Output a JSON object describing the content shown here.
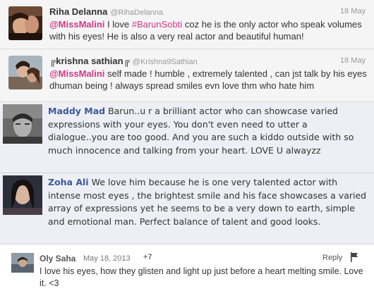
{
  "tweets": [
    {
      "name": "Riha Delanna",
      "handle": "@RihaDelanna",
      "date": "18 May",
      "mention": "@MissMalini",
      "text_a": " I love ",
      "hashtag": "#BarunSobti",
      "text_b": " coz he is the only actor who speak volumes with his eyes! He is also a very real actor and beautiful human!"
    },
    {
      "name": "╔krishna sathian╔",
      "handle": "@Krishna9Sathian",
      "date": "18 May",
      "mention": "@MissMalini",
      "text_a": " self made ! humble , extremely talented , can jst talk by his eyes dhuman being ! always spread smiles evn love thm who hate him"
    }
  ],
  "fb_comments": [
    {
      "author": "Maddy Mad",
      "text": " Barun..u r a brilliant actor who can showcase varied expressions with your eyes. You don't even need to utter a dialogue..you are too good. And you are such a kiddo outside with so much innocence and talking from your heart. LOVE U alwayzz"
    },
    {
      "author": "Zoha Ali",
      "text": " We love him because he is one very talented actor with intense most eyes , the brightest smile and his face showcases a varied array of expressions yet he seems to be a very down to earth, simple and emotional man. Perfect balance of talent and good looks."
    }
  ],
  "disqus_comment": {
    "author": "Oly Saha",
    "date": "May 18, 2013",
    "votes": "+7",
    "reply_label": "Reply",
    "flag_icon": "flag-icon",
    "text": "I love his eyes, how they glisten and light up just before a heart melting smile. Love it. <3"
  }
}
